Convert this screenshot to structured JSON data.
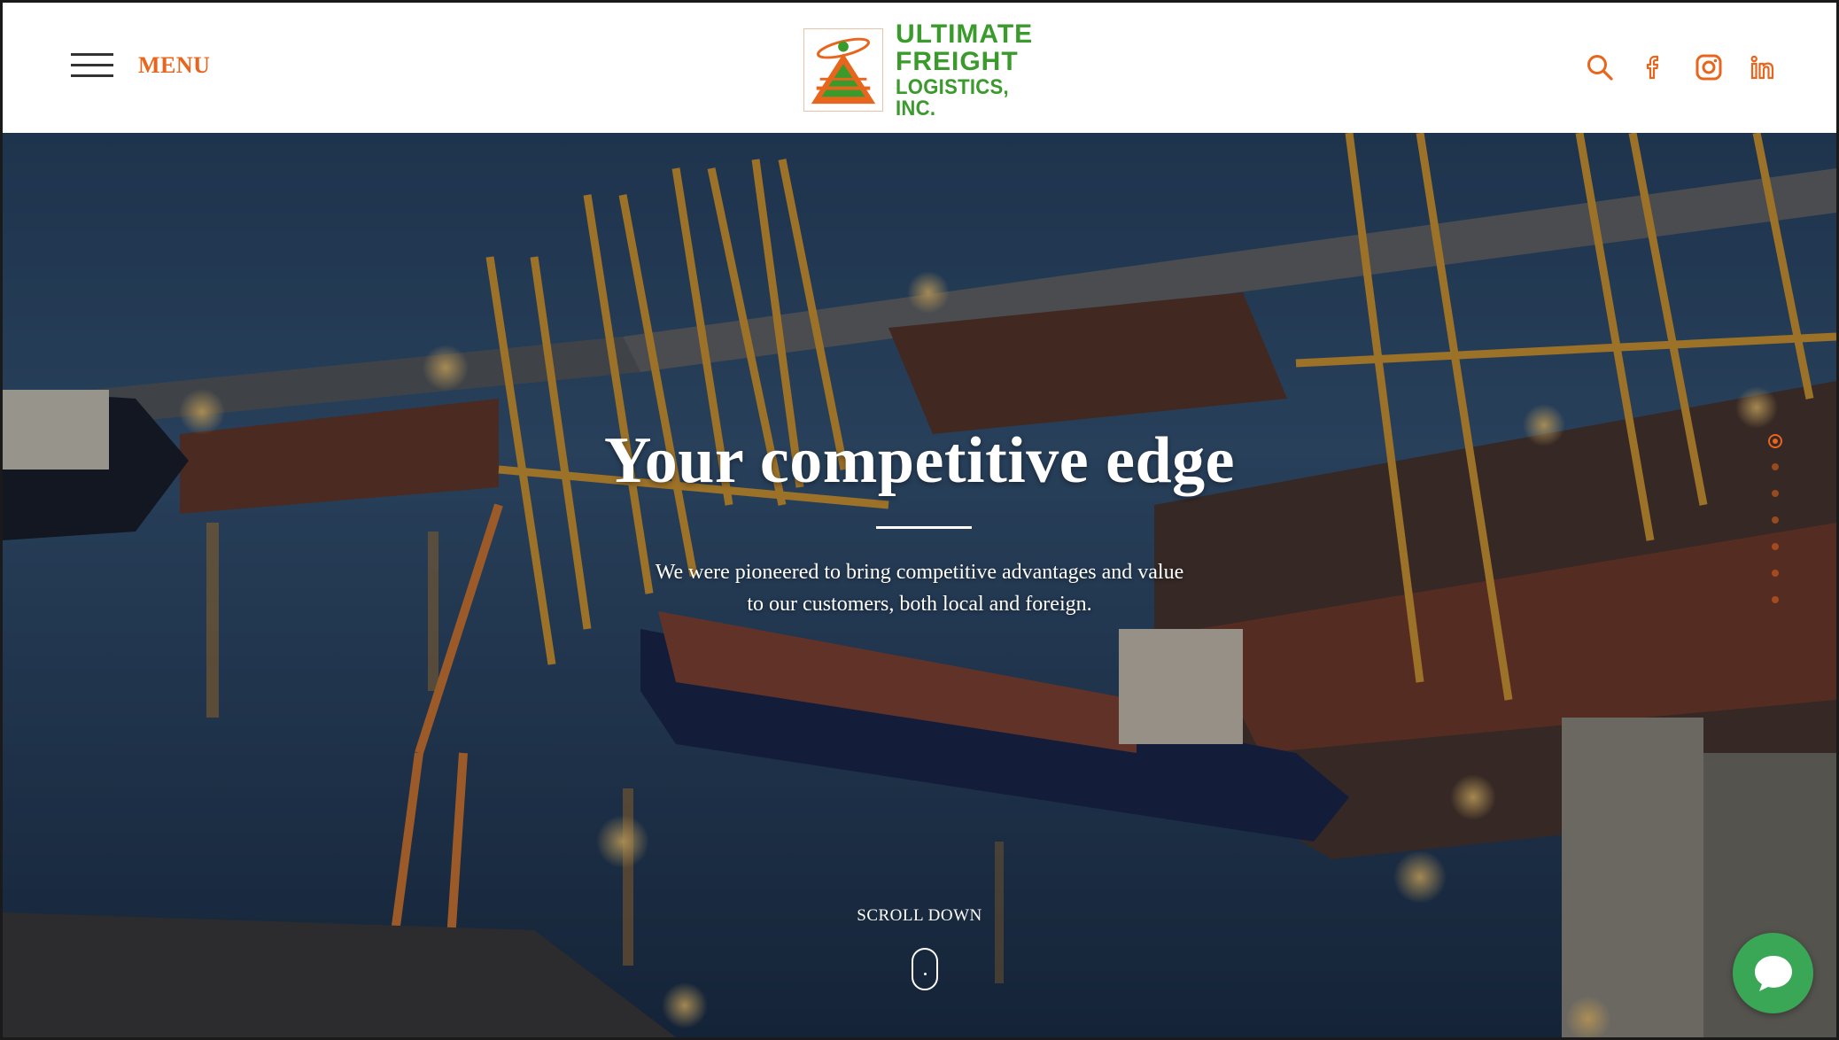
{
  "header": {
    "menu_label": "MENU",
    "logo": {
      "line1": "ULTIMATE",
      "line2": "FREIGHT",
      "line3": "LOGISTICS, INC."
    },
    "social_icons": [
      "search-icon",
      "facebook-icon",
      "instagram-icon",
      "linkedin-icon"
    ]
  },
  "hero": {
    "title": "Your competitive edge",
    "subtitle_line1": "We were pioneered to bring competitive advantages and value",
    "subtitle_line2": "to our customers, both local and foreign.",
    "scroll_label": "SCROLL DOWN",
    "slide_dots": 7,
    "active_slide": 1
  },
  "colors": {
    "accent_orange": "#e8651d",
    "logo_green": "#3a9a2b",
    "chat_green": "#3aa757"
  }
}
